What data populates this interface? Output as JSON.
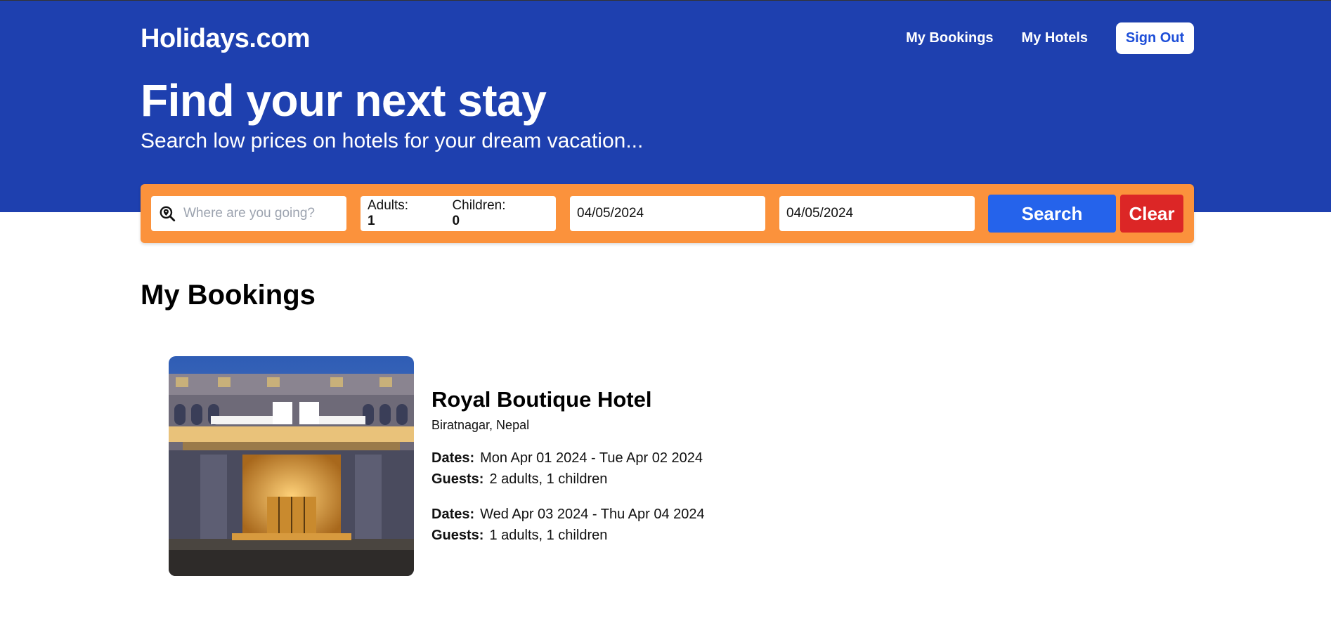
{
  "header": {
    "brand": "Holidays.com",
    "nav": {
      "my_bookings": "My Bookings",
      "my_hotels": "My Hotels",
      "sign_out": "Sign Out"
    },
    "headline": "Find your next stay",
    "subline": "Search low prices on hotels for your dream vacation..."
  },
  "search": {
    "destination_placeholder": "Where are you going?",
    "destination_value": "",
    "adults_label": "Adults:",
    "adults_value": "1",
    "children_label": "Children:",
    "children_value": "0",
    "check_in": "04/05/2024",
    "check_out": "04/05/2024",
    "search_label": "Search",
    "clear_label": "Clear"
  },
  "main": {
    "title": "My Bookings",
    "bookings": [
      {
        "hotel_name": "Royal Boutique Hotel",
        "location": "Biratnagar, Nepal",
        "stays": [
          {
            "dates_label": "Dates:",
            "dates": "Mon Apr 01 2024 - Tue Apr 02 2024",
            "guests_label": "Guests:",
            "guests": "2 adults, 1 children"
          },
          {
            "dates_label": "Dates:",
            "dates": "Wed Apr 03 2024 - Thu Apr 04 2024",
            "guests_label": "Guests:",
            "guests": "1 adults, 1 children"
          }
        ]
      }
    ]
  },
  "colors": {
    "hero_bg": "#1e40af",
    "search_bar_bg": "#fb923c",
    "search_button": "#2563eb",
    "clear_button": "#dc2626"
  },
  "icons": {
    "destination": "map-search-icon"
  }
}
